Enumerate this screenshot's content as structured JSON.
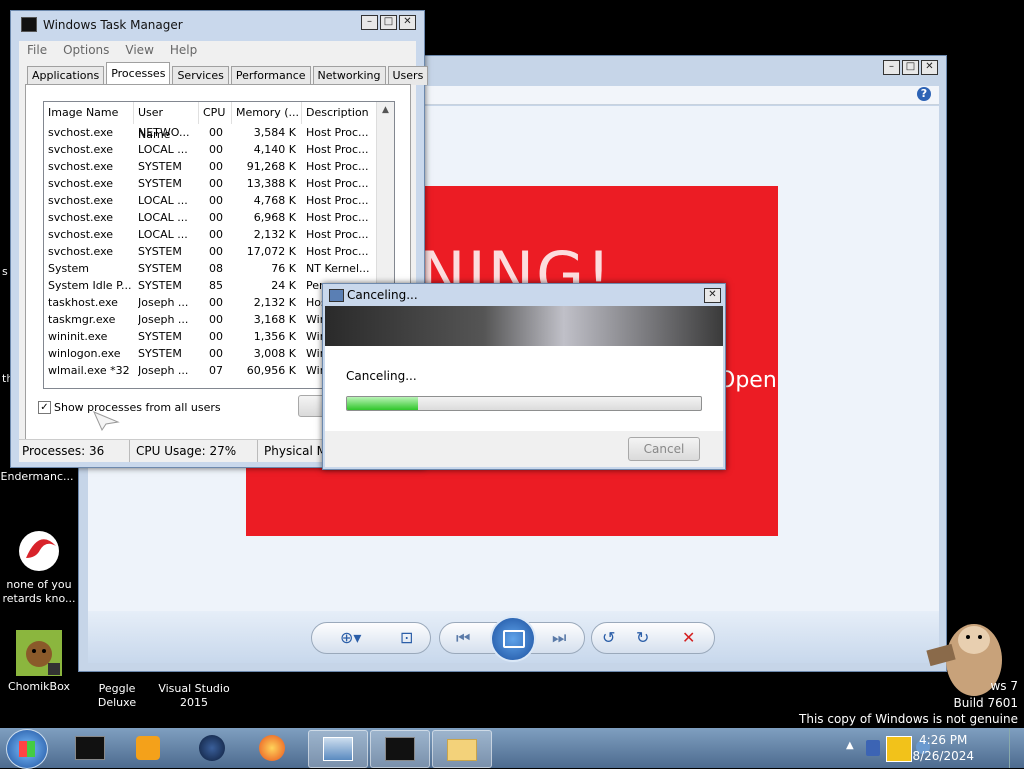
{
  "desktop": {
    "icons": [
      {
        "label": "Endermanc..."
      },
      {
        "label": "none of you retards kno..."
      },
      {
        "label": "ChomikBox"
      },
      {
        "label": "Peggle Deluxe"
      },
      {
        "label": "Visual Studio 2015"
      }
    ],
    "edge_letters": [
      "s",
      "th"
    ],
    "watermark": {
      "line1": "ws 7",
      "line2": "Build 7601",
      "line3": "This copy of Windows is not genuine"
    }
  },
  "photo_viewer": {
    "image_text_big": "RNING!",
    "image_text_open": "Open",
    "help_icon": "?",
    "colors": {
      "image_bg": "#ec1c24"
    }
  },
  "task_manager": {
    "title": "Windows Task Manager",
    "menu": [
      "File",
      "Options",
      "View",
      "Help"
    ],
    "tabs": [
      "Applications",
      "Processes",
      "Services",
      "Performance",
      "Networking",
      "Users"
    ],
    "active_tab": "Processes",
    "columns": [
      "Image Name",
      "User Name",
      "CPU",
      "Memory (...",
      "Description"
    ],
    "rows": [
      [
        "svchost.exe",
        "NETWO...",
        "00",
        "3,584 K",
        "Host Proc..."
      ],
      [
        "svchost.exe",
        "LOCAL ...",
        "00",
        "4,140 K",
        "Host Proc..."
      ],
      [
        "svchost.exe",
        "SYSTEM",
        "00",
        "91,268 K",
        "Host Proc..."
      ],
      [
        "svchost.exe",
        "SYSTEM",
        "00",
        "13,388 K",
        "Host Proc..."
      ],
      [
        "svchost.exe",
        "LOCAL ...",
        "00",
        "4,768 K",
        "Host Proc..."
      ],
      [
        "svchost.exe",
        "LOCAL ...",
        "00",
        "6,968 K",
        "Host Proc..."
      ],
      [
        "svchost.exe",
        "LOCAL ...",
        "00",
        "2,132 K",
        "Host Proc..."
      ],
      [
        "svchost.exe",
        "SYSTEM",
        "00",
        "17,072 K",
        "Host Proc..."
      ],
      [
        "System",
        "SYSTEM",
        "08",
        "76 K",
        "NT Kernel..."
      ],
      [
        "System Idle P...",
        "SYSTEM",
        "85",
        "24 K",
        "Per..."
      ],
      [
        "taskhost.exe",
        "Joseph ...",
        "00",
        "2,132 K",
        "Hos..."
      ],
      [
        "taskmgr.exe",
        "Joseph ...",
        "00",
        "3,168 K",
        "Win..."
      ],
      [
        "wininit.exe",
        "SYSTEM",
        "00",
        "1,356 K",
        "Win..."
      ],
      [
        "winlogon.exe",
        "SYSTEM",
        "00",
        "3,008 K",
        "Win..."
      ],
      [
        "wlmail.exe *32",
        "Joseph ...",
        "07",
        "60,956 K",
        "Win..."
      ]
    ],
    "show_all_label": "Show processes from all users",
    "show_all_checked": true,
    "end_button": "E",
    "status": {
      "processes": "Processes: 36",
      "cpu": "CPU Usage: 27%",
      "memory": "Physical Me"
    }
  },
  "cancel_dialog": {
    "title": "Canceling...",
    "message": "Canceling...",
    "progress": 0.2,
    "cancel_button": "Cancel",
    "close_icon": "✕"
  },
  "taskbar": {
    "clock_time": "4:26 PM",
    "clock_date": "8/26/2024"
  }
}
